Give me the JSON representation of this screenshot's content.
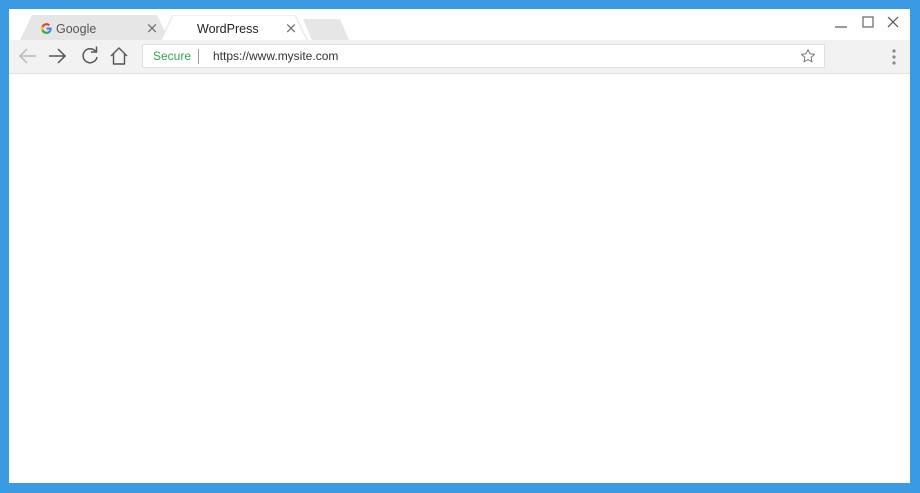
{
  "tabs": [
    {
      "label": "Google",
      "favicon": "google-g-icon",
      "active": false,
      "close": "×"
    },
    {
      "label": "WordPress",
      "active": true,
      "close": "×"
    }
  ],
  "toolbar": {
    "secure_label": "Secure",
    "url": "https://www.mysite.com"
  },
  "colors": {
    "frame": "#3a9be2",
    "secure": "#2fa84f",
    "toolbar": "#f2f2f2"
  }
}
